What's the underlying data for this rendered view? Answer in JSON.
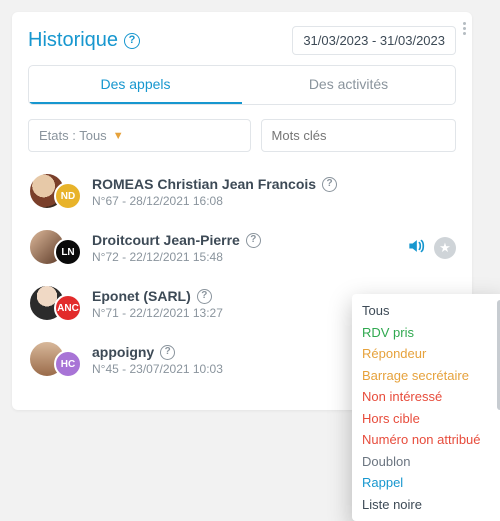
{
  "header": {
    "title": "Historique",
    "date_range": "31/03/2023 - 31/03/2023"
  },
  "tabs": [
    {
      "label": "Des appels",
      "active": true
    },
    {
      "label": "Des activités",
      "active": false
    }
  ],
  "filters": {
    "state_label": "Etats : Tous",
    "keywords_placeholder": "Mots clés"
  },
  "calls": [
    {
      "name": "ROMEAS Christian Jean Francois",
      "meta": "N°67 - 28/12/2021 16:08",
      "badge": "ND",
      "badge_color": "#e8b32a"
    },
    {
      "name": "Droitcourt Jean-Pierre",
      "meta": "N°72 - 22/12/2021 15:48",
      "badge": "LN",
      "badge_color": "#0a0a0a",
      "has_audio": true
    },
    {
      "name": "Eponet (SARL)",
      "meta": "N°71 - 22/12/2021 13:27",
      "badge": "ANC",
      "badge_color": "#e22b2b"
    },
    {
      "name": "appoigny",
      "meta": "N°45 - 23/07/2021 10:03",
      "badge": "HC",
      "badge_color": "#a874d6"
    }
  ],
  "status_menu": [
    {
      "label": "Tous",
      "color": "c-default"
    },
    {
      "label": "RDV pris",
      "color": "c-green"
    },
    {
      "label": "Répondeur",
      "color": "c-orange"
    },
    {
      "label": "Barrage secrétaire",
      "color": "c-orange"
    },
    {
      "label": "Non intéressé",
      "color": "c-red"
    },
    {
      "label": "Hors cible",
      "color": "c-red"
    },
    {
      "label": "Numéro non attribué",
      "color": "c-red"
    },
    {
      "label": "Doublon",
      "color": "c-grey"
    },
    {
      "label": "Rappel",
      "color": "c-blue"
    },
    {
      "label": "Liste noire",
      "color": "c-default"
    }
  ]
}
